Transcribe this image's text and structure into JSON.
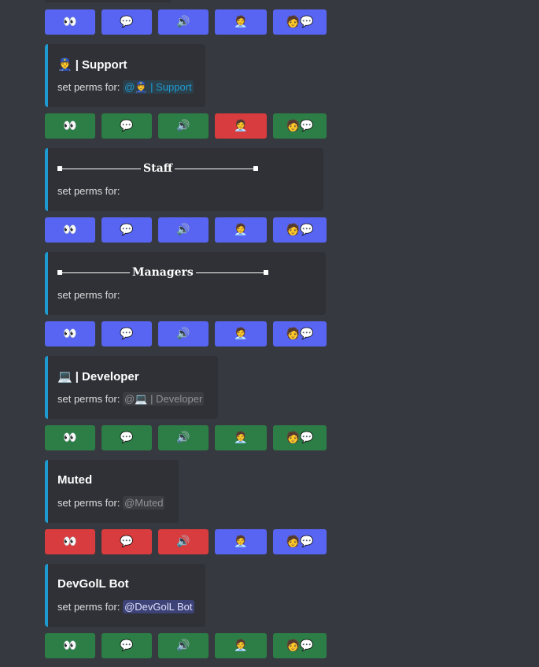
{
  "icons": {
    "view": "👀",
    "chat": "💬",
    "voice": "🔊",
    "manage": "🧑‍💼",
    "msg": "🧑‍💬"
  },
  "desc_prefix": "set perms for:",
  "embeds": [
    {
      "title": "| Support",
      "emoji": "👮",
      "mention": "@👮 | Support"
    },
    {
      "title": "Staff"
    },
    {
      "title": "Managers"
    },
    {
      "title": "| Developer",
      "emoji": "💻",
      "mention": "@💻 | Developer"
    },
    {
      "title": "Muted",
      "mention": "@Muted"
    },
    {
      "title": "DevGolL Bot",
      "mention": "@DevGolL Bot"
    }
  ],
  "colors": {
    "background": "#36393f",
    "embed_bg": "#2f3136",
    "embed_border": "#1e9bd1",
    "blurple": "#5865f2",
    "green": "#2d7d46",
    "red": "#d83c3e"
  }
}
